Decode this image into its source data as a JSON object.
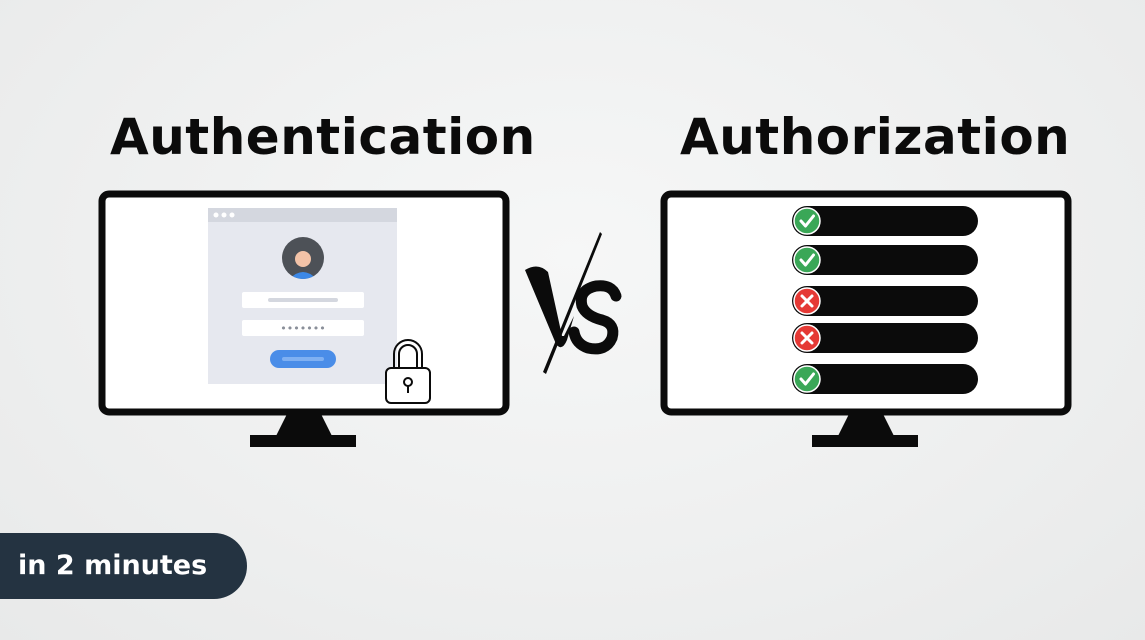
{
  "titles": {
    "left": "Authentication",
    "right": "Authorization"
  },
  "badge": {
    "label": "in 2 minutes"
  },
  "login_card": {
    "password_mask": "•••••••"
  },
  "permissions": [
    {
      "granted": true
    },
    {
      "granted": true
    },
    {
      "granted": false
    },
    {
      "granted": false
    },
    {
      "granted": true
    }
  ],
  "colors": {
    "monitor": "#0b0b0b",
    "granted": "#3aa757",
    "denied": "#e53935",
    "login_button": "#4a8de8",
    "badge": "#243341"
  },
  "icons": {
    "lock": "padlock-icon",
    "avatar": "user-avatar-icon",
    "granted": "check-circle-icon",
    "denied": "x-circle-icon"
  }
}
